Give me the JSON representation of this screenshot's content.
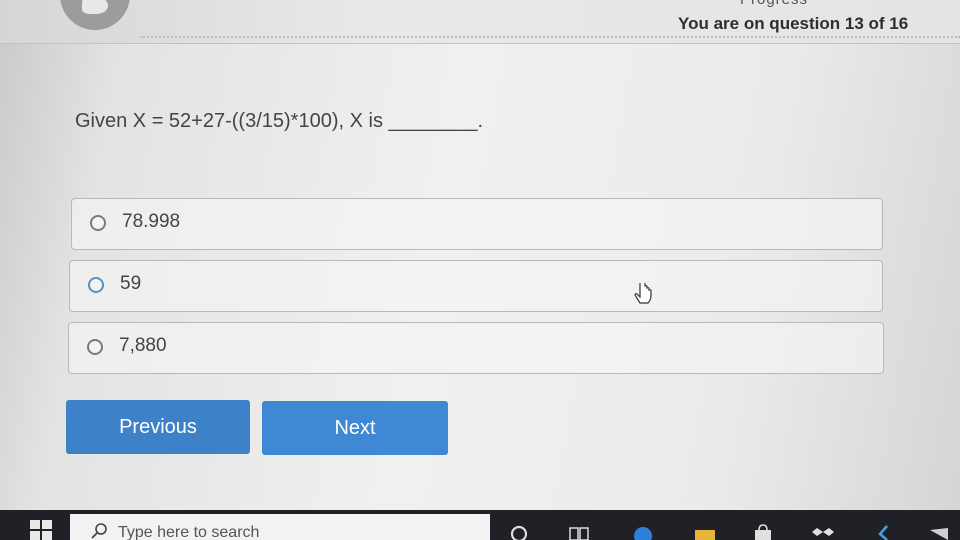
{
  "header": {
    "progress_label": "Progress",
    "question_counter": "You are on question 13 of 16"
  },
  "question": {
    "text": "Given X = 52+27-((3/15)*100), X is ________."
  },
  "options": [
    {
      "label": "78.998"
    },
    {
      "label": "59"
    },
    {
      "label": "7,880"
    }
  ],
  "buttons": {
    "previous_label": "Previous",
    "next_label": "Next"
  },
  "taskbar": {
    "search_placeholder": "Type here to search"
  },
  "colors": {
    "button_blue": "#3d82c9",
    "taskbar": "#1f2126"
  }
}
